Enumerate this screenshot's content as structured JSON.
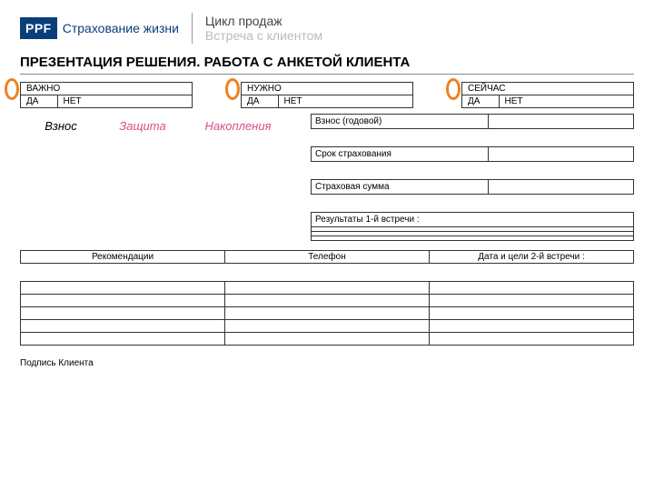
{
  "logo": {
    "abbrev": "PPF",
    "company": "Страхование жизни"
  },
  "header": {
    "line1": "Цикл продаж",
    "line2": "Встреча с клиентом"
  },
  "section_title": "ПРЕЗЕНТАЦИЯ РЕШЕНИЯ. РАБОТА С АНКЕТОЙ КЛИЕНТА",
  "yn": {
    "heads": [
      "ВАЖНО",
      "НУЖНО",
      "СЕЙЧАС"
    ],
    "yes": "ДА",
    "no": "НЕТ"
  },
  "concepts": {
    "c1": "Взнос",
    "c2": "Защита",
    "c3": "Накопления"
  },
  "side": {
    "r1": "Взнос (годовой)",
    "r2": "Срок страхования",
    "r3": "Страховая сумма",
    "r4": "Результаты 1-й встречи :"
  },
  "bottom": {
    "h1": "Рекомендации",
    "h2": "Телефон",
    "h3": "Дата и цели 2-й встречи :"
  },
  "sign": "Подпись Клиента"
}
